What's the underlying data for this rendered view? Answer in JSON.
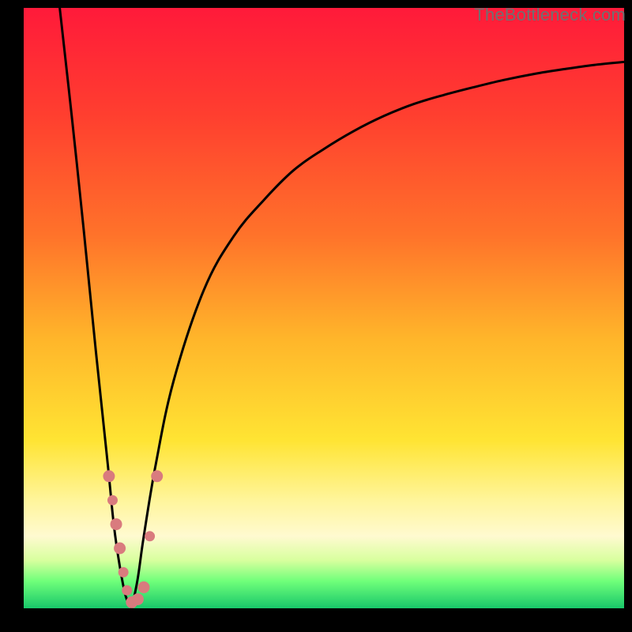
{
  "attribution": "TheBottleneck.com",
  "colors": {
    "bg_black": "#000000",
    "gradient_stops": [
      {
        "offset": 0.0,
        "color": "#ff1a3a"
      },
      {
        "offset": 0.18,
        "color": "#ff3f2f"
      },
      {
        "offset": 0.38,
        "color": "#ff732a"
      },
      {
        "offset": 0.55,
        "color": "#ffb52a"
      },
      {
        "offset": 0.72,
        "color": "#ffe433"
      },
      {
        "offset": 0.82,
        "color": "#fff59b"
      },
      {
        "offset": 0.88,
        "color": "#fffad0"
      },
      {
        "offset": 0.92,
        "color": "#d8ff9e"
      },
      {
        "offset": 0.955,
        "color": "#6fff7a"
      },
      {
        "offset": 1.0,
        "color": "#18c76a"
      }
    ],
    "curve": "#000000",
    "marker_fill": "#d97b7e",
    "marker_stroke": "#d97b7e"
  },
  "chart_data": {
    "type": "line",
    "title": "",
    "xlabel": "",
    "ylabel": "",
    "xlim": [
      0,
      100
    ],
    "ylim": [
      0,
      100
    ],
    "notch_x": 18,
    "series": [
      {
        "name": "left-branch",
        "x": [
          6,
          8,
          10,
          12,
          14,
          15,
          16,
          17,
          18
        ],
        "y": [
          100,
          82,
          63,
          43,
          24,
          14,
          7,
          2,
          0
        ]
      },
      {
        "name": "right-branch",
        "x": [
          18,
          19,
          20,
          22,
          25,
          30,
          35,
          40,
          45,
          50,
          55,
          60,
          65,
          70,
          75,
          80,
          85,
          90,
          95,
          100
        ],
        "y": [
          0,
          5,
          12,
          24,
          38,
          53,
          62,
          68,
          73,
          76.5,
          79.5,
          82,
          84,
          85.5,
          86.8,
          88,
          89,
          89.8,
          90.5,
          91
        ]
      }
    ],
    "markers": {
      "name": "highlighted-points",
      "points": [
        {
          "x": 14.2,
          "y": 22,
          "r": 7
        },
        {
          "x": 14.8,
          "y": 18,
          "r": 6
        },
        {
          "x": 15.4,
          "y": 14,
          "r": 7
        },
        {
          "x": 16.0,
          "y": 10,
          "r": 7
        },
        {
          "x": 16.6,
          "y": 6,
          "r": 6
        },
        {
          "x": 17.2,
          "y": 3,
          "r": 6
        },
        {
          "x": 18.0,
          "y": 1,
          "r": 7
        },
        {
          "x": 19.0,
          "y": 1.5,
          "r": 7
        },
        {
          "x": 20.0,
          "y": 3.5,
          "r": 7
        },
        {
          "x": 21.0,
          "y": 12,
          "r": 6
        },
        {
          "x": 22.2,
          "y": 22,
          "r": 7
        }
      ]
    }
  }
}
